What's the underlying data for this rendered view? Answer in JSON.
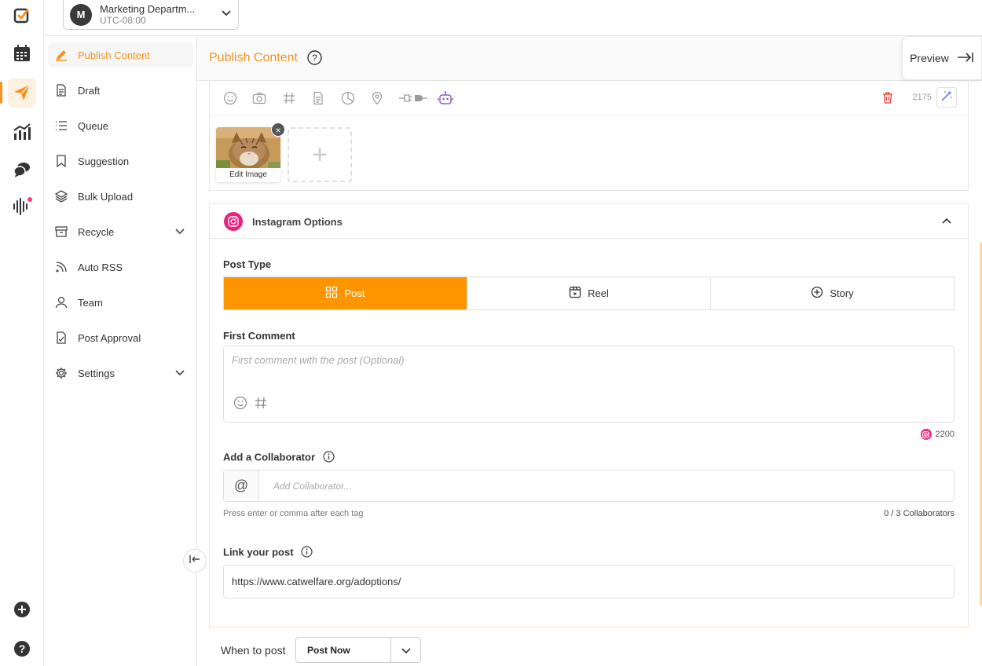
{
  "workspace": {
    "avatar_letter": "M",
    "name": "Marketing Departm...",
    "timezone": "UTC-08:00"
  },
  "rail": {
    "items": [
      {
        "name": "logo-icon"
      },
      {
        "name": "calendar-icon"
      },
      {
        "name": "send-icon",
        "active": true
      },
      {
        "name": "analytics-icon"
      },
      {
        "name": "chat-icon"
      },
      {
        "name": "listening-icon"
      },
      {
        "name": "add-icon"
      },
      {
        "name": "help-icon"
      }
    ]
  },
  "sidebar": {
    "items": [
      {
        "label": "Publish Content",
        "icon": "pen-icon",
        "active": true
      },
      {
        "label": "Draft",
        "icon": "document-icon"
      },
      {
        "label": "Queue",
        "icon": "list-icon"
      },
      {
        "label": "Suggestion",
        "icon": "bookmark-icon"
      },
      {
        "label": "Bulk Upload",
        "icon": "layers-icon"
      },
      {
        "label": "Recycle",
        "icon": "archive-icon",
        "expandable": true
      },
      {
        "label": "Auto RSS",
        "icon": "rss-icon"
      },
      {
        "label": "Team",
        "icon": "user-icon"
      },
      {
        "label": "Post Approval",
        "icon": "approval-icon"
      },
      {
        "label": "Settings",
        "icon": "gear-icon",
        "expandable": true
      }
    ]
  },
  "header": {
    "title": "Publish Content",
    "preview_label": "Preview"
  },
  "editor": {
    "toolbar_icons": [
      "emoji-icon",
      "camera-icon",
      "hashtag-icon",
      "document-icon",
      "chart-icon",
      "location-icon",
      "plug-icon",
      "robot-icon"
    ],
    "char_count": "2175",
    "media": {
      "thumb_label": "Edit Image"
    }
  },
  "instagram": {
    "title": "Instagram Options",
    "post_type_label": "Post Type",
    "post_types": [
      {
        "label": "Post",
        "active": true
      },
      {
        "label": "Reel"
      },
      {
        "label": "Story"
      }
    ],
    "first_comment_label": "First Comment",
    "first_comment_placeholder": "First comment with the post (Optional)",
    "char_limit": "2200",
    "collaborator_label": "Add a Collaborator",
    "collaborator_at": "@",
    "collaborator_placeholder": "Add Collaborator...",
    "collaborator_hint": "Press enter or comma after each tag",
    "collaborator_count": "0 / 3 Collaborators",
    "link_label": "Link your post",
    "link_value": "https://www.catwelfare.org/adoptions/"
  },
  "footer": {
    "when_label": "When to post",
    "when_value": "Post Now"
  },
  "colors": {
    "accent": "#fc9500",
    "instagram": "#e8247c",
    "delete": "#e53935"
  }
}
